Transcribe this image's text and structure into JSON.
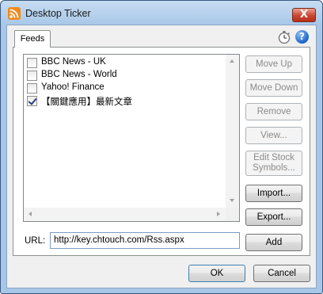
{
  "window": {
    "title": "Desktop Ticker",
    "close_glyph": "X"
  },
  "tabs": [
    {
      "label": "Feeds",
      "selected": true
    }
  ],
  "toolbar_icons": {
    "timer": "stopwatch-icon",
    "help": "help-icon",
    "help_glyph": "?"
  },
  "feeds": [
    {
      "label": "BBC News - UK",
      "checked": false
    },
    {
      "label": "BBC News - World",
      "checked": false
    },
    {
      "label": "Yahoo! Finance",
      "checked": false
    },
    {
      "label": "【關鍵應用】最新文章",
      "checked": true
    }
  ],
  "side_buttons": {
    "move_up": "Move Up",
    "move_down": "Move Down",
    "remove": "Remove",
    "view": "View...",
    "edit_stock_line1": "Edit Stock",
    "edit_stock_line2": "Symbols...",
    "import": "Import...",
    "export": "Export...",
    "add": "Add"
  },
  "url": {
    "label": "URL:",
    "value": "http://key.chtouch.com/Rss.aspx"
  },
  "footer": {
    "ok": "OK",
    "cancel": "Cancel"
  },
  "colors": {
    "frame": "#a8c6e6",
    "close": "#c8452e",
    "rss": "#f08a1c",
    "help": "#1d64c8"
  }
}
